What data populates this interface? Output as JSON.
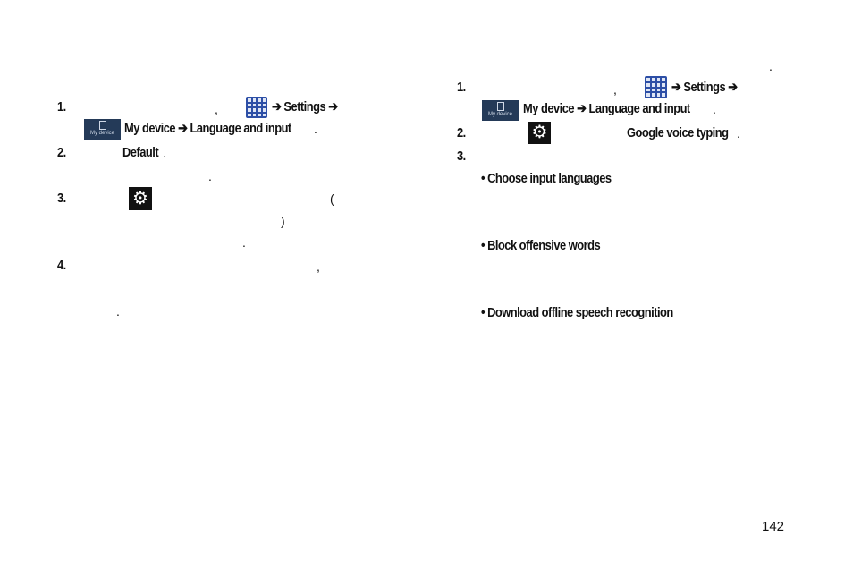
{
  "left": {
    "step1": {
      "num": "1.",
      "comma": ",",
      "nav": "➔ Settings ➔",
      "nav2": "My device ➔ Language and input",
      "period": "."
    },
    "step2": {
      "num": "2.",
      "item": "Default",
      "period": ".",
      "dot": "."
    },
    "step3": {
      "num": "3.",
      "open_paren": "(",
      "close_paren": ")",
      "dot": "."
    },
    "step4": {
      "num": "4.",
      "comma": ",",
      "dot": "."
    }
  },
  "right": {
    "top_dot": ".",
    "step1": {
      "num": "1.",
      "comma": ",",
      "nav": "➔ Settings ➔",
      "nav2": "My device ➔ Language and input",
      "period": "."
    },
    "step2": {
      "num": "2.",
      "item": "Google voice typing",
      "period": "."
    },
    "step3": {
      "num": "3."
    },
    "bullets": [
      "• Choose input languages",
      "• Block offensive words",
      "• Download offline speech recognition"
    ]
  },
  "icons": {
    "apps": "apps-grid-icon",
    "my_device_label": "My device",
    "gear": "settings-gear-icon"
  },
  "page_number": "142"
}
